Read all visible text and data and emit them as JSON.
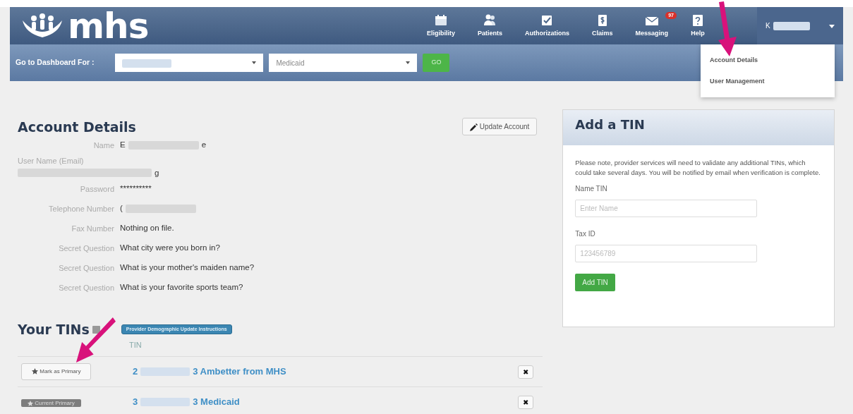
{
  "header": {
    "logo": "mhs",
    "nav": [
      {
        "kind": "calendar",
        "label": "Eligibility"
      },
      {
        "kind": "people",
        "label": "Patients"
      },
      {
        "kind": "check",
        "label": "Authorizations"
      },
      {
        "kind": "dollar",
        "label": "Claims"
      },
      {
        "kind": "envelope",
        "label": "Messaging",
        "badge": "97"
      },
      {
        "kind": "help",
        "label": "Help"
      }
    ],
    "user": {
      "initial": "K",
      "expanded": true
    },
    "menu": [
      {
        "label": "Account Details"
      },
      {
        "label": "User Management"
      }
    ]
  },
  "dashbar": {
    "label": "Go to Dashboard For :",
    "selects": [
      {
        "redacted": true
      },
      {
        "value": "Medicaid"
      }
    ],
    "button": "GO"
  },
  "account": {
    "title": "Account Details",
    "update_button": "Update Account",
    "fields": [
      {
        "kind": "inline",
        "label": "Name",
        "value_start": "E",
        "value_end": "e",
        "redacted": true
      },
      {
        "kind": "stacked",
        "label": "User Name (Email)",
        "value_end": "g",
        "redacted": true
      },
      {
        "kind": "inline",
        "label": "Password",
        "value_start": "**********"
      },
      {
        "kind": "inline",
        "label": "Telephone Number",
        "value_start": "(",
        "redacted": true
      },
      {
        "kind": "inline",
        "label": "Fax Number",
        "value_start": "Nothing on file."
      },
      {
        "kind": "inline",
        "label": "Secret Question",
        "value_start": "What city were you born in?"
      },
      {
        "kind": "inline",
        "label": "Secret Question",
        "value_start": "What is your mother's maiden name?"
      },
      {
        "kind": "inline",
        "label": "Secret Question",
        "value_start": "What is your favorite sports team?"
      }
    ]
  },
  "tins": {
    "title": "Your TINs",
    "instructions_button": "Provider Demographic Update Instructions",
    "column": "TIN",
    "rows": [
      {
        "primary": false,
        "action": "Mark as Primary",
        "tin_start": "2",
        "tin_end": "3 Ambetter from MHS",
        "delete": "✖"
      },
      {
        "primary": true,
        "action": "Current Primary",
        "tin_start": "3",
        "tin_end": "3 Medicaid",
        "delete": "✖"
      }
    ]
  },
  "add_tin": {
    "title": "Add a TIN",
    "note": "Please note, provider services will need to validate any additional TINs, which could take several days. You will be notified by email when verification is complete.",
    "fields": [
      {
        "label": "Name TIN",
        "placeholder": "Enter Name"
      },
      {
        "label": "Tax ID",
        "placeholder": "123456789"
      }
    ],
    "button": "Add TIN"
  }
}
